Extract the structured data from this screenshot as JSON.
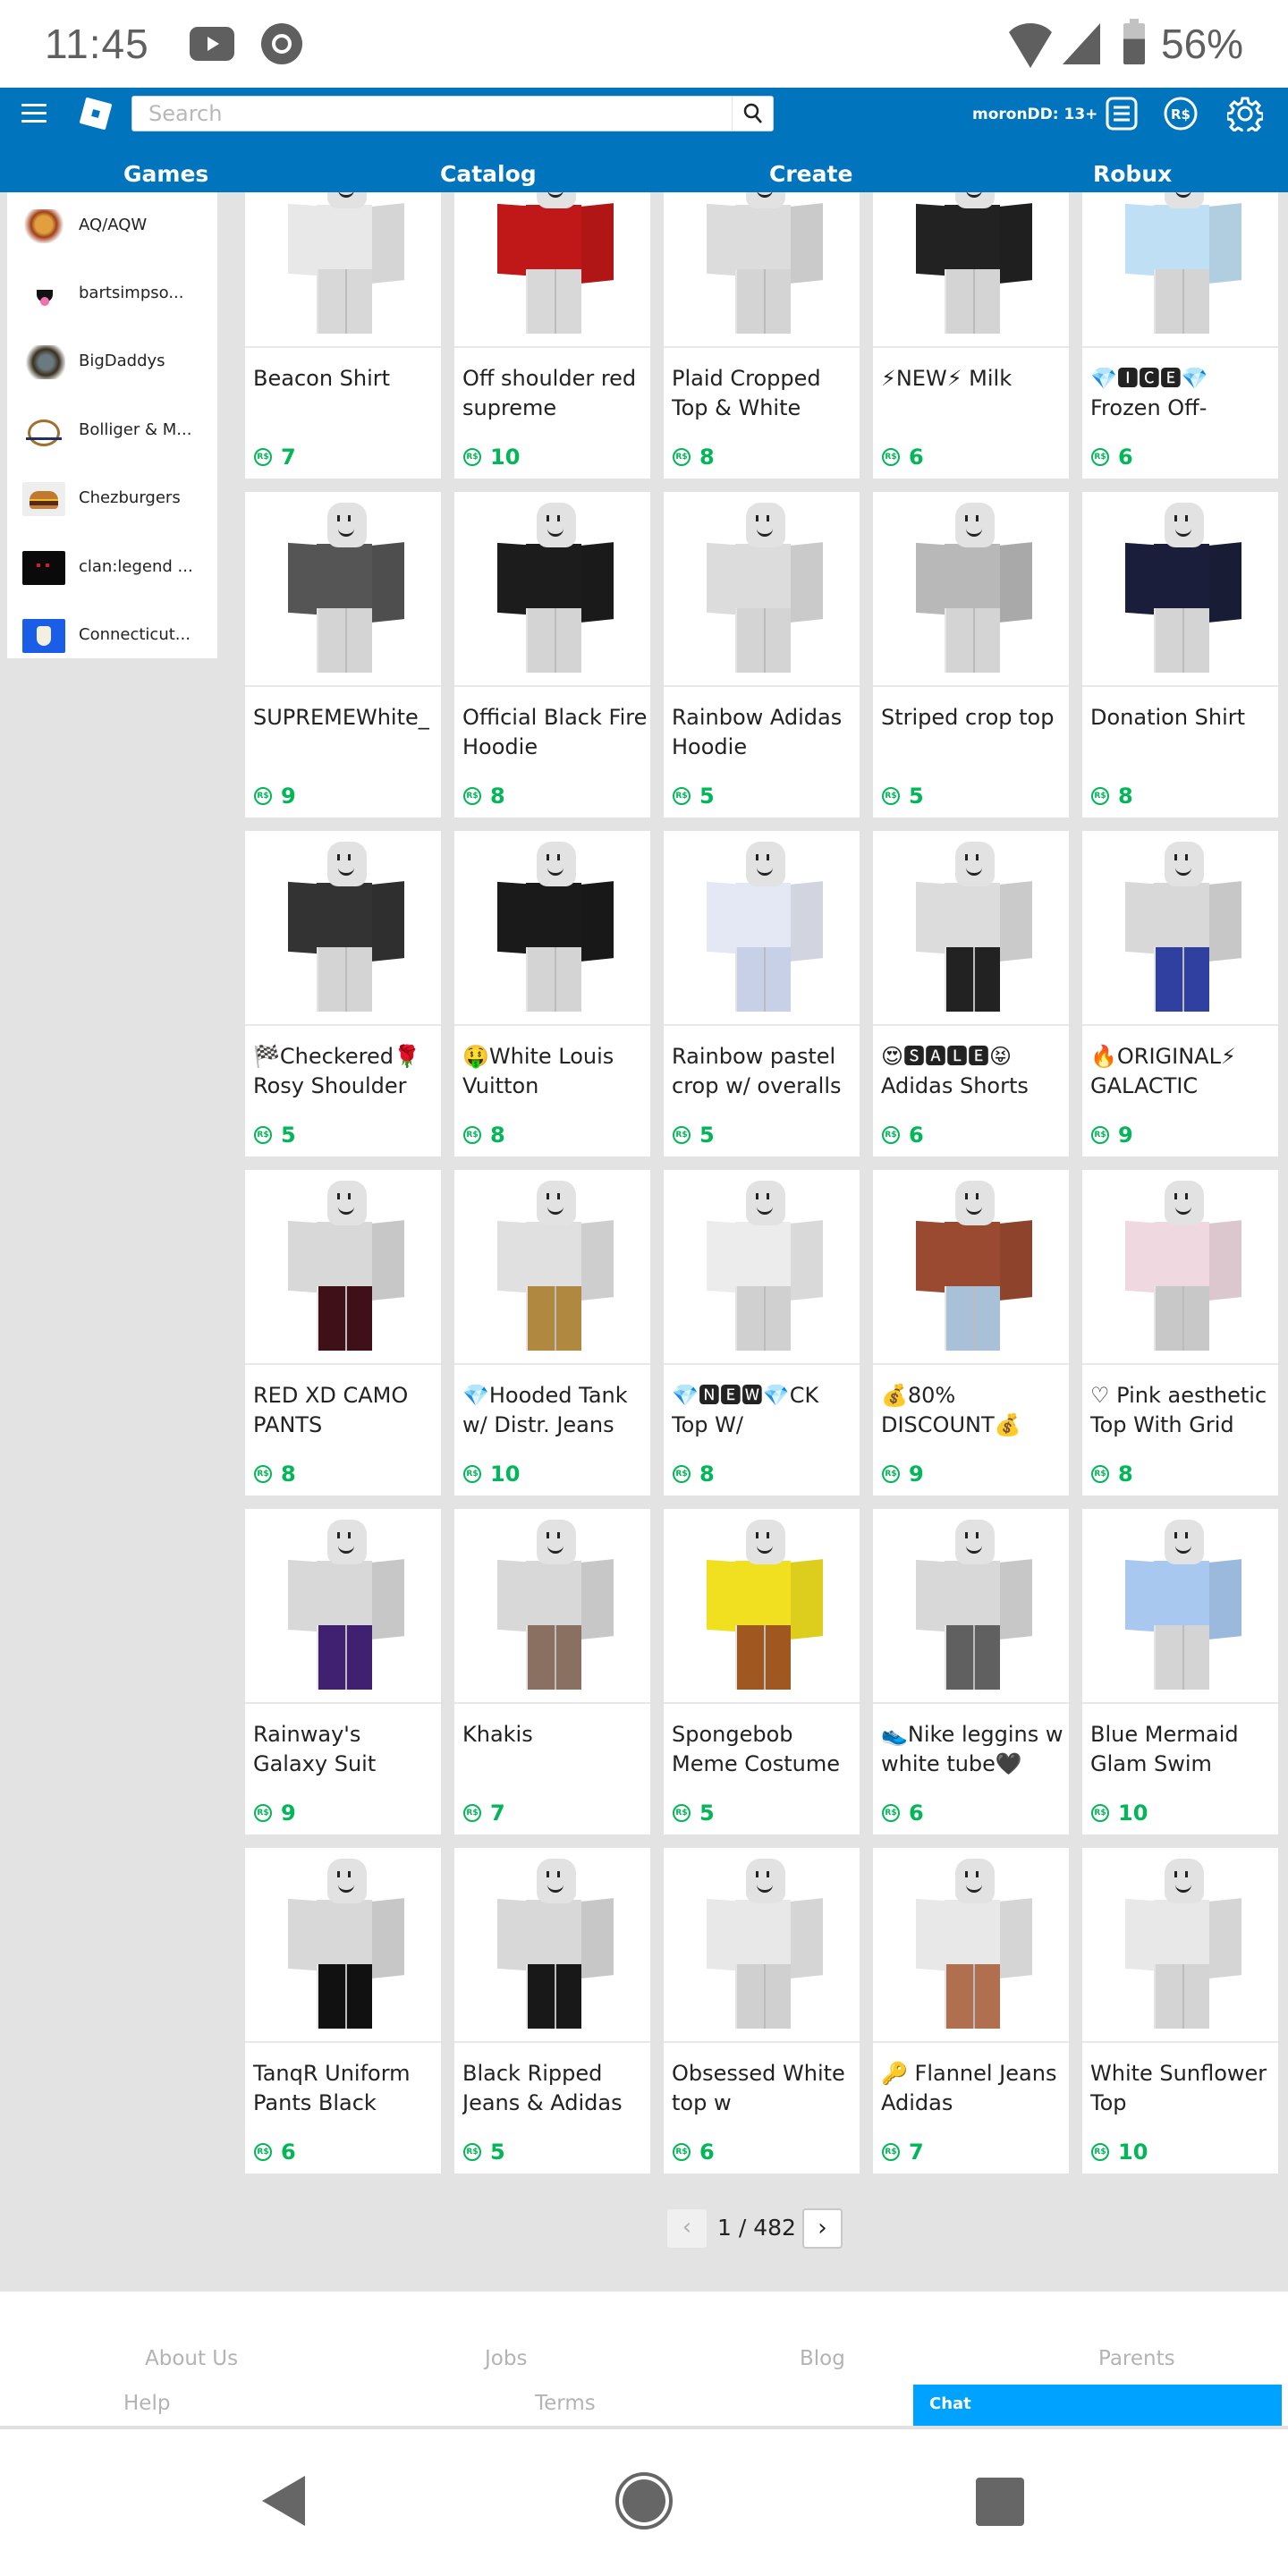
{
  "status_bar": {
    "time": "11:45",
    "battery_percent": "56%",
    "notification_icons": [
      "youtube-icon",
      "chrome-icon"
    ],
    "system_icons": [
      "wifi-icon",
      "cell-signal-icon",
      "battery-icon"
    ]
  },
  "header": {
    "search_placeholder": "Search",
    "search_value": "",
    "username": "moronDD: 13+",
    "icons": [
      "hamburger-menu-icon",
      "roblox-logo-icon",
      "search-icon",
      "messages-icon",
      "robux-icon",
      "settings-gear-icon"
    ],
    "tabs": [
      {
        "label": "Games"
      },
      {
        "label": "Catalog"
      },
      {
        "label": "Create"
      },
      {
        "label": "Robux"
      }
    ],
    "brand_color": "#0074bd"
  },
  "sidebar": {
    "items": [
      {
        "label": "AQ/AQW"
      },
      {
        "label": "bartsimpso..."
      },
      {
        "label": "BigDaddys"
      },
      {
        "label": "Bolliger & M..."
      },
      {
        "label": "Chezburgers"
      },
      {
        "label": "clan:legend ..."
      },
      {
        "label": "Connecticut..."
      }
    ]
  },
  "catalog": {
    "currency_icon": "robux-icon",
    "price_color": "#02b757",
    "items": [
      {
        "name": "Beacon Shirt",
        "price": "7"
      },
      {
        "name": "Off shoulder red supreme",
        "price": "10"
      },
      {
        "name": "Plaid Cropped Top & White",
        "price": "8"
      },
      {
        "name": "⚡NEW⚡ Milk",
        "price": "6"
      },
      {
        "name": "💎🅸🅲🅴💎 Frozen Off-",
        "price": "6"
      },
      {
        "name": "SUPREMEWhite_",
        "price": "9"
      },
      {
        "name": "Official Black Fire Hoodie",
        "price": "8"
      },
      {
        "name": "Rainbow Adidas Hoodie",
        "price": "5"
      },
      {
        "name": "Striped crop top",
        "price": "5"
      },
      {
        "name": "Donation Shirt",
        "price": "8"
      },
      {
        "name": "🏁Checkered🌹 Rosy Shoulder",
        "price": "5"
      },
      {
        "name": "🤑White Louis Vuitton",
        "price": "8"
      },
      {
        "name": "Rainbow pastel crop w/ overalls",
        "price": "5"
      },
      {
        "name": "😍🆂🅰🅻🅴😝 Adidas Shorts",
        "price": "6"
      },
      {
        "name": "🔥ORIGINAL⚡ GALACTIC",
        "price": "9"
      },
      {
        "name": "RED XD CAMO PANTS",
        "price": "8"
      },
      {
        "name": "💎Hooded Tank w/ Distr. Jeans",
        "price": "10"
      },
      {
        "name": "💎🅽🅴🆆💎CK Top W/",
        "price": "8"
      },
      {
        "name": "💰80% DISCOUNT💰",
        "price": "9"
      },
      {
        "name": "♡ Pink aesthetic Top With Grid",
        "price": "8"
      },
      {
        "name": "Rainway's Galaxy Suit",
        "price": "9"
      },
      {
        "name": "Khakis",
        "price": "7"
      },
      {
        "name": "Spongebob Meme Costume",
        "price": "5"
      },
      {
        "name": "👟Nike leggins w white tube🖤",
        "price": "6"
      },
      {
        "name": "Blue Mermaid Glam Swim",
        "price": "10"
      },
      {
        "name": "TanqR Uniform Pants Black",
        "price": "6"
      },
      {
        "name": "Black Ripped Jeans & Adidas",
        "price": "5"
      },
      {
        "name": "Obsessed White top w",
        "price": "6"
      },
      {
        "name": "🔑 Flannel Jeans Adidas",
        "price": "7"
      },
      {
        "name": "White Sunflower Top",
        "price": "10"
      }
    ]
  },
  "pagination": {
    "prev_label": "‹",
    "next_label": "›",
    "current_page": 1,
    "total_pages": 482,
    "text": "1 / 482"
  },
  "footer": {
    "links_row1": [
      "About Us",
      "Jobs",
      "Blog",
      "Parents"
    ],
    "links_row2": [
      "Help",
      "Terms"
    ],
    "chat_label": "Chat",
    "chat_color": "#00a2ff"
  },
  "nav_bar": {
    "buttons": [
      "back-icon",
      "home-icon",
      "recents-icon"
    ]
  }
}
